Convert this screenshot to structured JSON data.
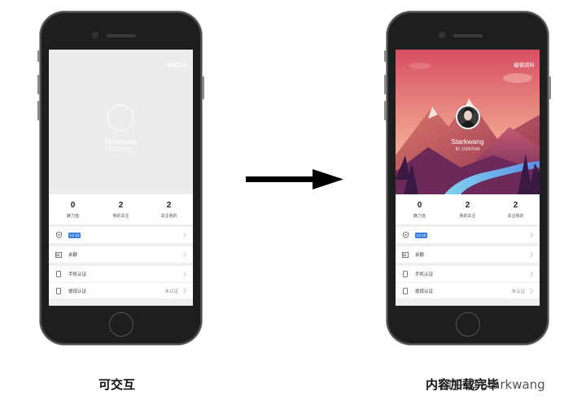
{
  "phones": {
    "left": {
      "header": {
        "edit_label": "编辑资料",
        "username": "Starkwang",
        "user_id": "ID: 10047049"
      },
      "stats": [
        {
          "value": "0",
          "label": "魅力值"
        },
        {
          "value": "2",
          "label": "我的关注"
        },
        {
          "value": "2",
          "label": "关注我的"
        }
      ],
      "rows": {
        "level_badge": "LV 10",
        "balance_label": "余额",
        "phone_auth_label": "手机认证",
        "withdraw_auth_label": "提现认证",
        "withdraw_auth_status": "未认证"
      }
    },
    "right": {
      "header": {
        "edit_label": "编辑资料",
        "username": "Starkwang",
        "user_id": "ID: 10047049"
      },
      "stats": [
        {
          "value": "0",
          "label": "魅力值"
        },
        {
          "value": "2",
          "label": "我的关注"
        },
        {
          "value": "2",
          "label": "关注我的"
        }
      ],
      "rows": {
        "level_badge": "LV 10",
        "balance_label": "余额",
        "phone_auth_label": "手机认证",
        "withdraw_auth_label": "提现认证",
        "withdraw_auth_status": "未认证"
      }
    }
  },
  "captions": {
    "left": "可交互",
    "right": "内容加载完毕"
  },
  "watermark": "知乎 @Starkwang",
  "colors": {
    "accent": "#3d7ee6",
    "arrow": "#000000",
    "device": "#1e1e1e"
  }
}
